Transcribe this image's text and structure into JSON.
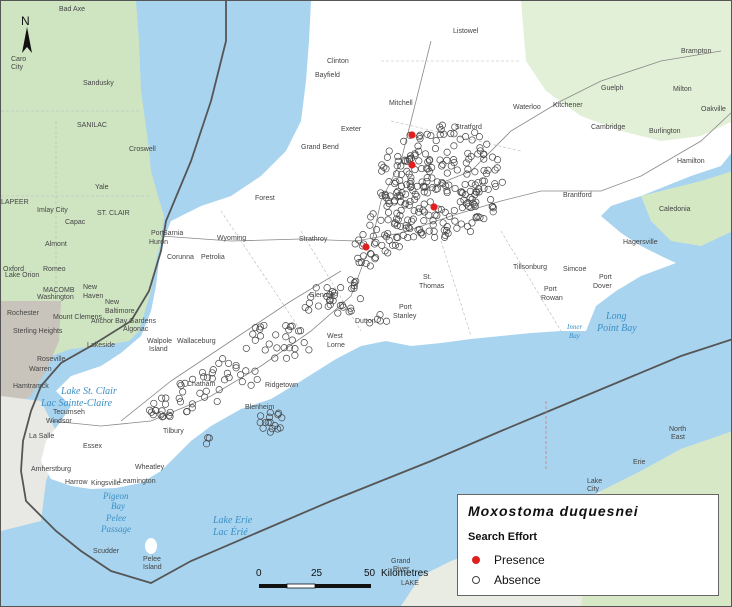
{
  "legend": {
    "title": "Moxostoma duquesnei",
    "subtitle": "Search Effort",
    "presence_label": "Presence",
    "absence_label": "Absence",
    "presence_color": "#e0201f",
    "absence_color": "#444444"
  },
  "scale": {
    "tick0": "0",
    "tick1": "25",
    "tick2": "50",
    "unit": "Kilometres"
  },
  "north_label": "N",
  "water_labels": {
    "lake_st_clair_en": "Lake St. Clair",
    "lake_st_clair_fr": "Lac Sainte-Claire",
    "lake_erie_en": "Lake Erie",
    "lake_erie_fr": "Lac Érié",
    "long_point_bay_1": "Long",
    "long_point_bay_2": "Point Bay",
    "pigeon_bay_1": "Pigeon",
    "pigeon_bay_2": "Bay",
    "pelee_passage_1": "Pelee",
    "pelee_passage_2": "Passage",
    "inner_bay_1": "Inner",
    "inner_bay_2": "Bay"
  },
  "places": {
    "sarnia": "Sarnia",
    "windsor": "Windsor",
    "chatham": "Chatham",
    "leamington": "Leamington",
    "tilbury": "Tilbury",
    "strathroy": "Strathroy",
    "st_thomas_1": "St.",
    "st_thomas_2": "Thomas",
    "port_stanley_1": "Port",
    "port_stanley_2": "Stanley",
    "dutton": "Dutton",
    "west_lorne_1": "West",
    "west_lorne_2": "Lorne",
    "glencoe": "Glencoe",
    "ridgetown": "Ridgetown",
    "blenheim": "Blenheim",
    "wallaceburg": "Wallaceburg",
    "wheatley": "Wheatley",
    "kingsville": "Kingsville",
    "harrow": "Harrow",
    "amherstburg": "Amherstburg",
    "essex": "Essex",
    "tecumseh": "Tecumseh",
    "lasalle": "La Salle",
    "exeter": "Exeter",
    "clinton": "Clinton",
    "bayfield": "Bayfield",
    "grand_bend": "Grand Bend",
    "forest": "Forest",
    "petrolia": "Petrolia",
    "wyoming": "Wyoming",
    "corunna": "Corunna",
    "mitchell": "Mitchell",
    "stratford": "Stratford",
    "brantford": "Brantford",
    "tillsonburg": "Tillsonburg",
    "simcoe": "Simcoe",
    "port_dover_1": "Port",
    "port_dover_2": "Dover",
    "port_rowan_1": "Port",
    "port_rowan_2": "Rowan",
    "hamilton": "Hamilton",
    "burlington": "Burlington",
    "waterloo": "Waterloo",
    "kitchener": "Kitchener",
    "guelph": "Guelph",
    "cambridge": "Cambridge",
    "brampton": "Brampton",
    "oakville": "Oakville",
    "milton": "Milton",
    "caledonia": "Caledonia",
    "hagersville": "Hagersville",
    "listowel": "Listowel",
    "port_huron_1": "Port",
    "port_huron_2": "Huron",
    "sandusky": "Sandusky",
    "sanilac": "SANILAC",
    "st_clair_county": "ST. CLAIR",
    "macomb": "MACOMB",
    "lapeer": "LAPEER",
    "capac": "Capac",
    "yale": "Yale",
    "imlay_city": "Imlay City",
    "almont": "Almont",
    "romeo": "Romeo",
    "new_haven_1": "New",
    "new_haven_2": "Haven",
    "new_baltimore_1": "New",
    "new_baltimore_2": "Baltimore",
    "algonac": "Algonac",
    "anchor_bay": "Anchor Bay Gardens",
    "mount_clemens": "Mount Clemens",
    "sterling_heights": "Sterling Heights",
    "warren": "Warren",
    "roseville": "Roseville",
    "hamtramck": "Hamtramck",
    "rochester": "Rochester",
    "lake_orion": "Lake Orion",
    "lakeside": "Lakeside",
    "walpole_1": "Walpole",
    "walpole_2": "Island",
    "pelee_island_1": "Pelee",
    "pelee_island_2": "Island",
    "scudder": "Scudder",
    "washington": "Washington",
    "bad_axe": "Bad Axe",
    "croswell": "Croswell",
    "grand_river_1": "Grand",
    "grand_river_2": "River",
    "north_east_1": "North",
    "north_east_2": "East",
    "erie": "Erie",
    "lake_city_1": "Lake",
    "lake_city_2": "City",
    "lake_label": "LAKE",
    "oxford": "Oxford",
    "caro_city_1": "Caro",
    "caro_city_2": "City"
  }
}
